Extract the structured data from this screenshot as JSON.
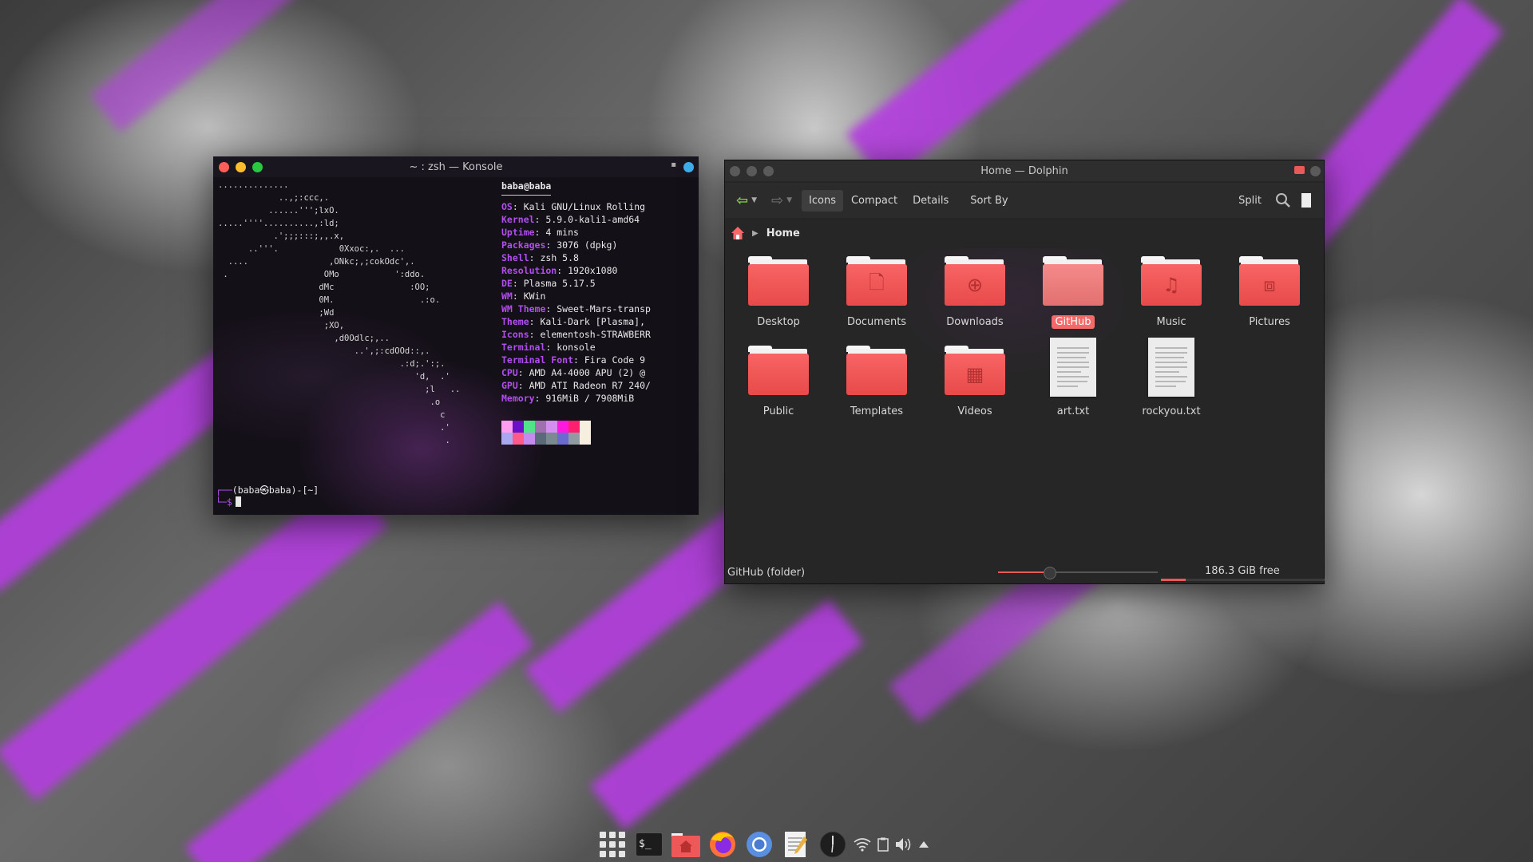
{
  "konsole": {
    "title": "~ : zsh — Konsole",
    "ascii_logo": "..............\n            ..,;:ccc,.\n          ......''';lxO.\n.....''''..........,:ld;\n           .';;;:::;,,.x,\n      ..'''.            0Xxoc:,.  ...\n  ....                ,ONkc;,;cokOdc',.\n .                   OMo           ':ddo.\n                    dMc               :OO;\n                    0M.                 .:o.\n                    ;Wd\n                     ;XO,\n                       ,d0Odlc;,..\n                           ..',;:cdOOd::,.\n                                    .:d;.':;.\n                                       'd,  .'\n                                         ;l   ..\n                                          .o\n                                            c\n                                            .'\n                                             .",
    "user_host": "baba@baba",
    "info": [
      {
        "key": "OS",
        "value": "Kali GNU/Linux Rolling"
      },
      {
        "key": "Kernel",
        "value": "5.9.0-kali1-amd64"
      },
      {
        "key": "Uptime",
        "value": "4 mins"
      },
      {
        "key": "Packages",
        "value": "3076 (dpkg)"
      },
      {
        "key": "Shell",
        "value": "zsh 5.8"
      },
      {
        "key": "Resolution",
        "value": "1920x1080"
      },
      {
        "key": "DE",
        "value": "Plasma 5.17.5"
      },
      {
        "key": "WM",
        "value": "KWin"
      },
      {
        "key": "WM Theme",
        "value": "Sweet-Mars-transp"
      },
      {
        "key": "Theme",
        "value": "Kali-Dark [Plasma],"
      },
      {
        "key": "Icons",
        "value": "elementosh-STRAWBERR"
      },
      {
        "key": "Terminal",
        "value": "konsole"
      },
      {
        "key": "Terminal Font",
        "value": "Fira Code 9"
      },
      {
        "key": "CPU",
        "value": "AMD A4-4000 APU (2) @"
      },
      {
        "key": "GPU",
        "value": "AMD ATI Radeon R7 240/"
      },
      {
        "key": "Memory",
        "value": "916MiB / 7908MiB"
      }
    ],
    "palette_top": [
      "#ff9ef0",
      "#6a10c8",
      "#52e28a",
      "#a06fae",
      "#d48ef0",
      "#ff18e0",
      "#ff1f6e",
      "#f6efe0"
    ],
    "palette_bottom": [
      "#a8a8f0",
      "#ff5a8a",
      "#c48af0",
      "#5a6a78",
      "#7a8a90",
      "#6a6ad0",
      "#909aa0",
      "#f6efe0"
    ],
    "prompt_line1": "(baba㉿baba)-[~]",
    "prompt_line2": "$"
  },
  "dolphin": {
    "title": "Home — Dolphin",
    "toolbar": {
      "icons": "Icons",
      "compact": "Compact",
      "details": "Details",
      "sort_by": "Sort By",
      "split": "Split"
    },
    "breadcrumb": "Home",
    "items": [
      {
        "name": "Desktop",
        "glyph": ""
      },
      {
        "name": "Documents",
        "glyph": "🗋"
      },
      {
        "name": "Downloads",
        "glyph": "⊕"
      },
      {
        "name": "GitHub",
        "glyph": ""
      },
      {
        "name": "Music",
        "glyph": "♫"
      },
      {
        "name": "Pictures",
        "glyph": "⧈"
      },
      {
        "name": "Public",
        "glyph": ""
      },
      {
        "name": "Templates",
        "glyph": ""
      },
      {
        "name": "Videos",
        "glyph": "▦"
      },
      {
        "name": "art.txt",
        "glyph": ""
      },
      {
        "name": "rockyou.txt",
        "glyph": ""
      }
    ],
    "status": {
      "selected": "GitHub (folder)",
      "free_space": "186.3 GiB free",
      "zoom_level": 0.32,
      "disk_used_fraction": 0.15
    }
  },
  "dock": {
    "items": [
      "app-launcher",
      "terminal",
      "file-manager",
      "firefox",
      "chromium",
      "text-editor",
      "clock",
      "network",
      "clipboard",
      "volume",
      "system-tray-expand"
    ]
  }
}
